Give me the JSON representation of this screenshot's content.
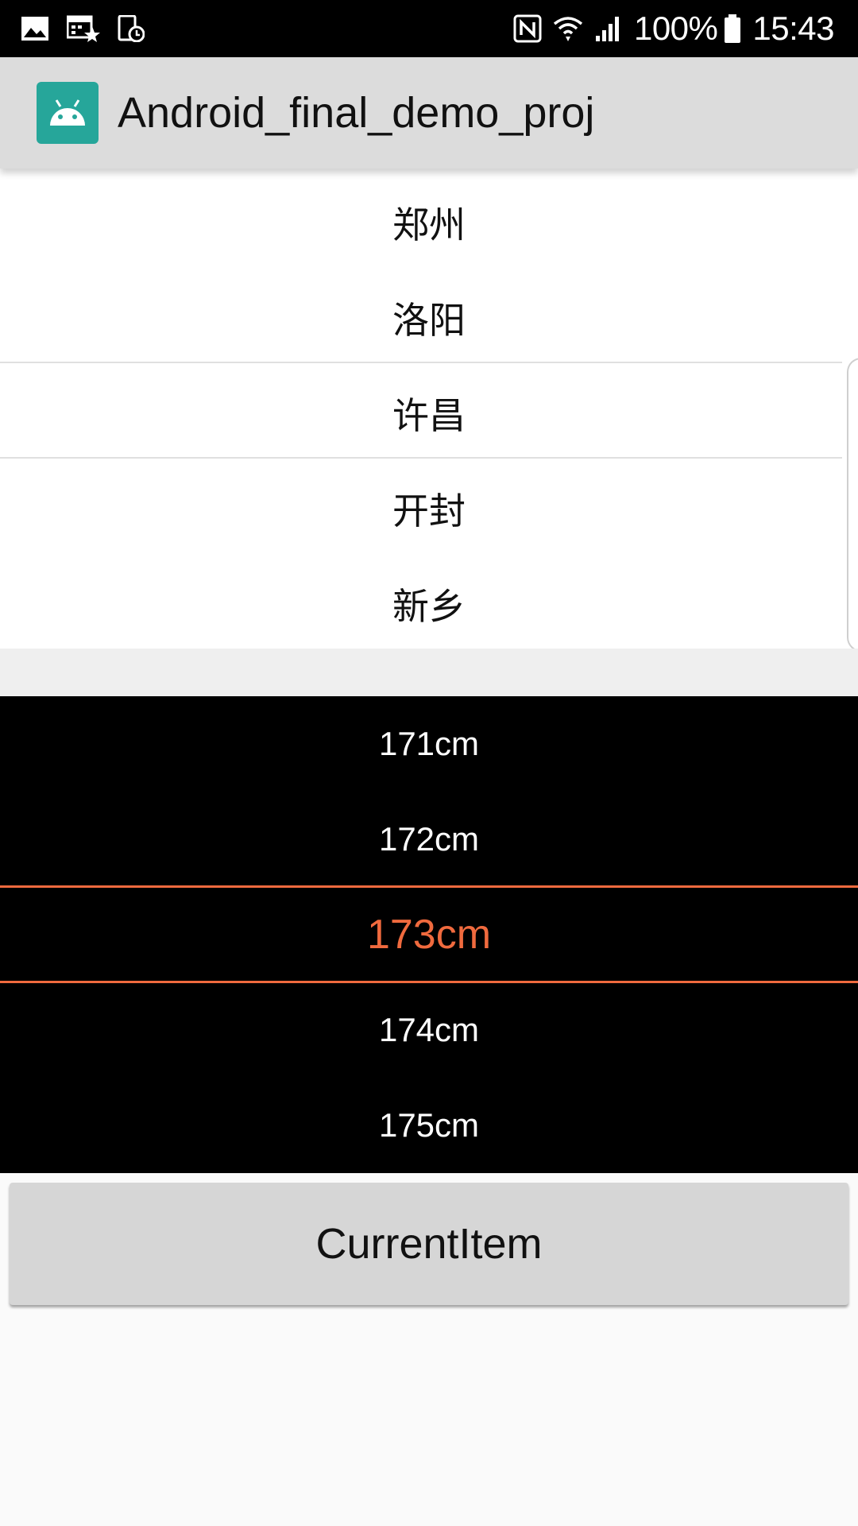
{
  "status_bar": {
    "battery_percent": "100%",
    "time": "15:43",
    "left_icons": [
      "image-icon",
      "calendar-star-icon",
      "device-clock-icon"
    ],
    "right_icons": [
      "nfc-icon",
      "wifi-icon",
      "signal-icon",
      "battery-icon"
    ]
  },
  "app_bar": {
    "title": "Android_final_demo_proj",
    "icon": "android-icon"
  },
  "city_picker": {
    "items": [
      "郑州",
      "洛阳",
      "许昌",
      "开封",
      "新乡"
    ],
    "selected": "许昌"
  },
  "height_picker": {
    "items": [
      "171cm",
      "172cm",
      "173cm",
      "174cm",
      "175cm"
    ],
    "selected": "173cm",
    "accent_color": "#f06a3e"
  },
  "button": {
    "label": "CurrentItem"
  },
  "colors": {
    "status_bar": "#000000",
    "app_bar": "#dcdcdc",
    "app_icon": "#26a69a",
    "height_wheel_bg": "#000000",
    "button_bg": "#d6d6d6"
  }
}
